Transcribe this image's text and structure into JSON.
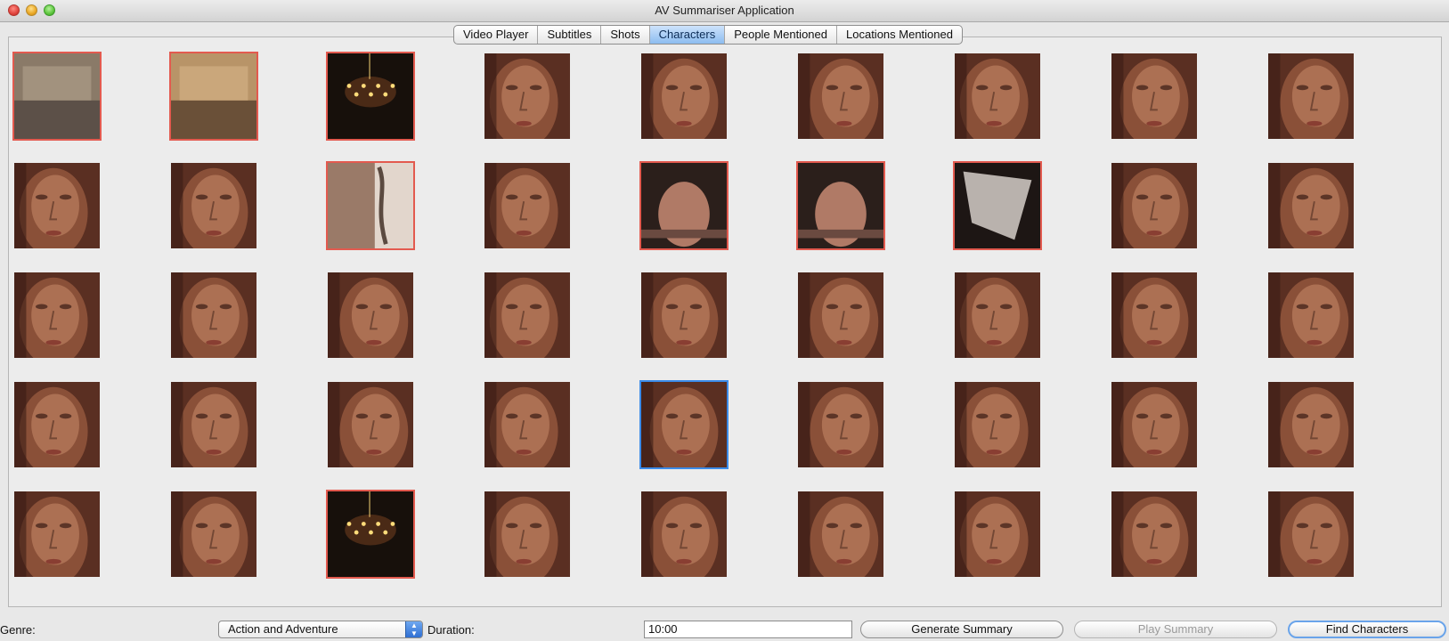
{
  "window": {
    "title": "AV Summariser Application"
  },
  "tabs": [
    {
      "label": "Video Player",
      "selected": false
    },
    {
      "label": "Subtitles",
      "selected": false
    },
    {
      "label": "Shots",
      "selected": false
    },
    {
      "label": "Characters",
      "selected": true
    },
    {
      "label": "People Mentioned",
      "selected": false
    },
    {
      "label": "Locations Mentioned",
      "selected": false
    }
  ],
  "thumbnails": {
    "rows": 5,
    "columns": 9,
    "items": [
      {
        "row": 1,
        "col": 1,
        "subject": "blurred scene",
        "state": "flagged"
      },
      {
        "row": 1,
        "col": 2,
        "subject": "blurred object",
        "state": "flagged"
      },
      {
        "row": 1,
        "col": 3,
        "subject": "chandelier",
        "state": "flagged"
      },
      {
        "row": 1,
        "col": 4,
        "subject": "face",
        "state": "normal"
      },
      {
        "row": 1,
        "col": 5,
        "subject": "face",
        "state": "normal"
      },
      {
        "row": 1,
        "col": 6,
        "subject": "face",
        "state": "normal"
      },
      {
        "row": 1,
        "col": 7,
        "subject": "face",
        "state": "normal"
      },
      {
        "row": 1,
        "col": 8,
        "subject": "face",
        "state": "normal"
      },
      {
        "row": 1,
        "col": 9,
        "subject": "face",
        "state": "normal"
      },
      {
        "row": 2,
        "col": 1,
        "subject": "face",
        "state": "normal"
      },
      {
        "row": 2,
        "col": 2,
        "subject": "face",
        "state": "normal"
      },
      {
        "row": 2,
        "col": 3,
        "subject": "partial face",
        "state": "flagged"
      },
      {
        "row": 2,
        "col": 4,
        "subject": "face",
        "state": "normal"
      },
      {
        "row": 2,
        "col": 5,
        "subject": "hand",
        "state": "flagged"
      },
      {
        "row": 2,
        "col": 6,
        "subject": "hand",
        "state": "flagged"
      },
      {
        "row": 2,
        "col": 7,
        "subject": "cloth",
        "state": "flagged"
      },
      {
        "row": 2,
        "col": 8,
        "subject": "face",
        "state": "normal"
      },
      {
        "row": 2,
        "col": 9,
        "subject": "face",
        "state": "normal"
      },
      {
        "row": 3,
        "col": 1,
        "subject": "face",
        "state": "normal"
      },
      {
        "row": 3,
        "col": 2,
        "subject": "face",
        "state": "normal"
      },
      {
        "row": 3,
        "col": 3,
        "subject": "face",
        "state": "normal"
      },
      {
        "row": 3,
        "col": 4,
        "subject": "face",
        "state": "normal"
      },
      {
        "row": 3,
        "col": 5,
        "subject": "face",
        "state": "normal"
      },
      {
        "row": 3,
        "col": 6,
        "subject": "face",
        "state": "normal"
      },
      {
        "row": 3,
        "col": 7,
        "subject": "face",
        "state": "normal"
      },
      {
        "row": 3,
        "col": 8,
        "subject": "face",
        "state": "normal"
      },
      {
        "row": 3,
        "col": 9,
        "subject": "face",
        "state": "normal"
      },
      {
        "row": 4,
        "col": 1,
        "subject": "face",
        "state": "normal"
      },
      {
        "row": 4,
        "col": 2,
        "subject": "face",
        "state": "normal"
      },
      {
        "row": 4,
        "col": 3,
        "subject": "face",
        "state": "normal"
      },
      {
        "row": 4,
        "col": 4,
        "subject": "face",
        "state": "normal"
      },
      {
        "row": 4,
        "col": 5,
        "subject": "face",
        "state": "selected"
      },
      {
        "row": 4,
        "col": 6,
        "subject": "face",
        "state": "normal"
      },
      {
        "row": 4,
        "col": 7,
        "subject": "face",
        "state": "normal"
      },
      {
        "row": 4,
        "col": 8,
        "subject": "face",
        "state": "normal"
      },
      {
        "row": 4,
        "col": 9,
        "subject": "face",
        "state": "normal"
      },
      {
        "row": 5,
        "col": 1,
        "subject": "face",
        "state": "normal"
      },
      {
        "row": 5,
        "col": 2,
        "subject": "face",
        "state": "normal"
      },
      {
        "row": 5,
        "col": 3,
        "subject": "chandelier",
        "state": "flagged"
      },
      {
        "row": 5,
        "col": 4,
        "subject": "face",
        "state": "normal"
      },
      {
        "row": 5,
        "col": 5,
        "subject": "face",
        "state": "normal"
      },
      {
        "row": 5,
        "col": 6,
        "subject": "face",
        "state": "normal"
      },
      {
        "row": 5,
        "col": 7,
        "subject": "face",
        "state": "normal"
      },
      {
        "row": 5,
        "col": 8,
        "subject": "face",
        "state": "normal"
      },
      {
        "row": 5,
        "col": 9,
        "subject": "face",
        "state": "normal"
      }
    ]
  },
  "controls": {
    "genre_label": "Genre:",
    "genre_value": "Action and Adventure",
    "duration_label": "Duration:",
    "duration_value": "10:00",
    "generate_button": "Generate Summary",
    "play_button": "Play Summary",
    "play_enabled": false,
    "find_button": "Find Characters"
  },
  "colors": {
    "flagged_border": "#e35a4f",
    "selected_border": "#3b8be9",
    "selected_tab": "#8cbcf0"
  }
}
